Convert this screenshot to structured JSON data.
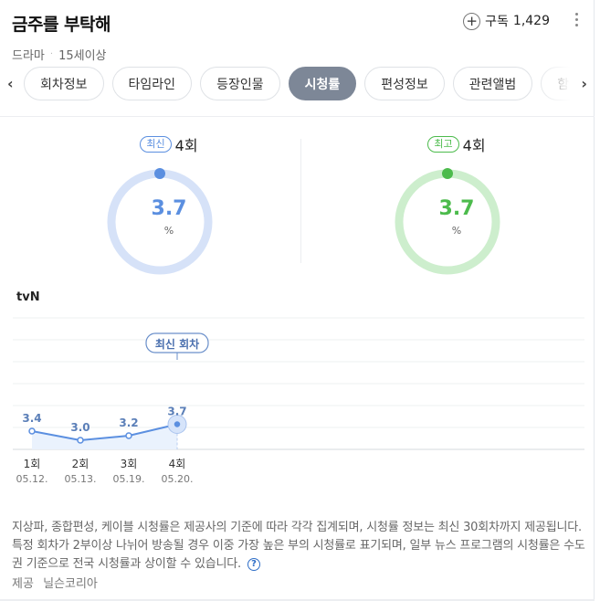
{
  "header": {
    "title": "금주를 부탁해",
    "genre": "드라마",
    "age": "15세이상",
    "subscribe_label": "구독",
    "subscribe_count": "1,429"
  },
  "tabs": [
    {
      "label": "회차정보",
      "active": false
    },
    {
      "label": "타임라인",
      "active": false
    },
    {
      "label": "등장인물",
      "active": false
    },
    {
      "label": "시청률",
      "active": true
    },
    {
      "label": "편성정보",
      "active": false
    },
    {
      "label": "관련앨범",
      "active": false
    },
    {
      "label": "함께 볼만한",
      "active": false
    }
  ],
  "latest": {
    "badge": "최신",
    "episode": "4회",
    "value": "3.7",
    "unit": "%",
    "color": "#5b8fe0",
    "ring": "#d6e2f8"
  },
  "highest": {
    "badge": "최고",
    "episode": "4회",
    "value": "3.7",
    "unit": "%",
    "color": "#4cbb4c",
    "ring": "#cdeecd"
  },
  "channel": "tvN",
  "chart_data": {
    "type": "line",
    "categories": [
      "1회",
      "2회",
      "3회",
      "4회"
    ],
    "dates": [
      "05.12.",
      "05.13.",
      "05.19.",
      "05.20."
    ],
    "values": [
      3.4,
      3.0,
      3.2,
      3.7
    ],
    "value_labels": [
      "3.4",
      "3.0",
      "3.2",
      "3.7"
    ],
    "annotation": "최신 회차",
    "color": "#5b8fe0"
  },
  "note": {
    "text": "지상파, 종합편성, 케이블 시청률은 제공사의 기준에 따라 각각 집계되며, 시청률 정보는 최신 30회차까지 제공됩니다. 특정 회차가 2부이상 나뉘어 방송될 경우 이중 가장 높은 부의 시청률로 표기되며, 일부 뉴스 프로그램의 시청률은 수도권 기준으로 전국 시청률과 상이할 수 있습니다.",
    "help": "?"
  },
  "source": {
    "label": "제공",
    "name": "닐슨코리아"
  }
}
